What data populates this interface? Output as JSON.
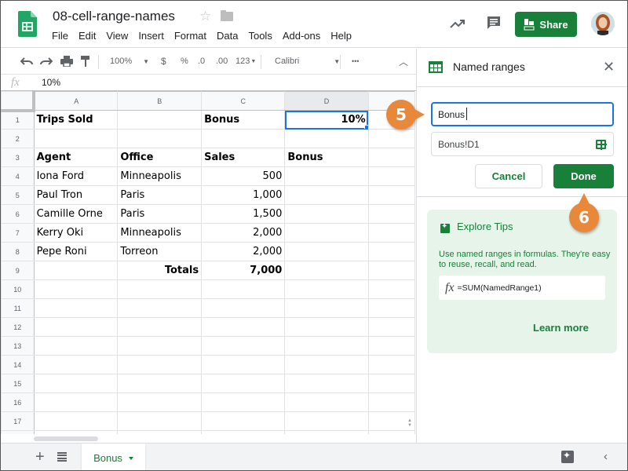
{
  "header": {
    "doc_title": "08-cell-range-names",
    "menu": [
      "File",
      "Edit",
      "View",
      "Insert",
      "Format",
      "Data",
      "Tools",
      "Add-ons",
      "Help"
    ],
    "share_label": "Share"
  },
  "toolbar": {
    "zoom": "100%",
    "currency": "$",
    "percent": "%",
    "decrease_decimal": ".0",
    "increase_decimal": ".00",
    "number_format": "123",
    "font": "Calibri",
    "more": "•••"
  },
  "formula_bar": {
    "fx_label": "fx",
    "value": "10%"
  },
  "sheet": {
    "columns": [
      "A",
      "B",
      "C",
      "D",
      ""
    ],
    "selected_column": "D",
    "rows": [
      {
        "num": "1",
        "cells": [
          "Trips Sold",
          "",
          "Bonus",
          "10%",
          ""
        ]
      },
      {
        "num": "2",
        "cells": [
          "",
          "",
          "",
          "",
          ""
        ]
      },
      {
        "num": "3",
        "cells": [
          "Agent",
          "Office",
          "Sales",
          "Bonus",
          ""
        ]
      },
      {
        "num": "4",
        "cells": [
          "Iona Ford",
          "Minneapolis",
          "500",
          "",
          ""
        ]
      },
      {
        "num": "5",
        "cells": [
          "Paul Tron",
          "Paris",
          "1,000",
          "",
          ""
        ]
      },
      {
        "num": "6",
        "cells": [
          "Camille Orne",
          "Paris",
          "1,500",
          "",
          ""
        ]
      },
      {
        "num": "7",
        "cells": [
          "Kerry Oki",
          "Minneapolis",
          "2,000",
          "",
          ""
        ]
      },
      {
        "num": "8",
        "cells": [
          "Pepe Roni",
          "Torreon",
          "2,000",
          "",
          ""
        ]
      },
      {
        "num": "9",
        "cells": [
          "",
          "Totals",
          "7,000",
          "",
          ""
        ]
      },
      {
        "num": "10",
        "cells": [
          "",
          "",
          "",
          "",
          ""
        ]
      },
      {
        "num": "11",
        "cells": [
          "",
          "",
          "",
          "",
          ""
        ]
      },
      {
        "num": "12",
        "cells": [
          "",
          "",
          "",
          "",
          ""
        ]
      },
      {
        "num": "13",
        "cells": [
          "",
          "",
          "",
          "",
          ""
        ]
      },
      {
        "num": "14",
        "cells": [
          "",
          "",
          "",
          "",
          ""
        ]
      },
      {
        "num": "15",
        "cells": [
          "",
          "",
          "",
          "",
          ""
        ]
      },
      {
        "num": "16",
        "cells": [
          "",
          "",
          "",
          "",
          ""
        ]
      },
      {
        "num": "17",
        "cells": [
          "",
          "",
          "",
          "",
          ""
        ]
      },
      {
        "num": "",
        "cells": [
          "",
          "",
          "",
          "",
          ""
        ]
      }
    ],
    "selected_cell": "D1"
  },
  "sheet_tabs": {
    "active": "Bonus"
  },
  "panel": {
    "title": "Named ranges",
    "name_value": "Bonus",
    "range_value": "Bonus!D1",
    "cancel_label": "Cancel",
    "done_label": "Done",
    "tips": {
      "title": "Explore Tips",
      "text": "Use named ranges in formulas. They're easy to reuse, recall, and read.",
      "formula": "=SUM(NamedRange1)",
      "learn_more": "Learn more"
    }
  },
  "callouts": {
    "step5": "5",
    "step6": "6"
  },
  "colors": {
    "brand_green": "#188038",
    "selection_blue": "#1a73e8",
    "callout_orange": "#e8883a",
    "tips_background": "#e6f4ea"
  }
}
